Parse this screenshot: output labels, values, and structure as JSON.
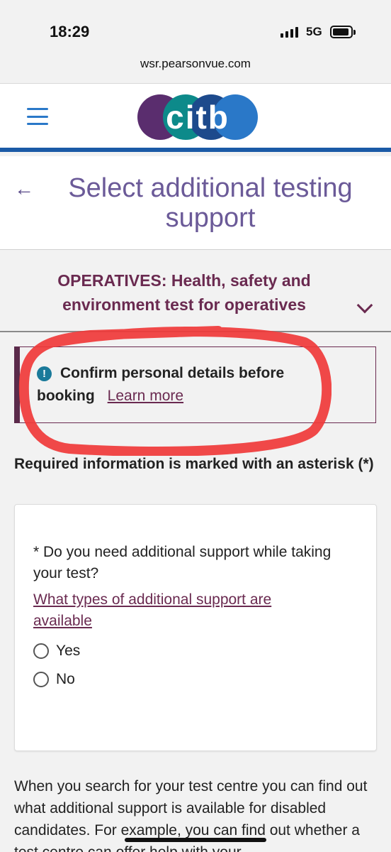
{
  "status_bar": {
    "time": "18:29",
    "network": "5G",
    "url": "wsr.pearsonvue.com"
  },
  "header": {
    "logo_text": "citb",
    "logo_colors": [
      "#5a2d6e",
      "#0d8a8a",
      "#1d4a8c",
      "#2a78c8"
    ],
    "accent": "#1b5aa6"
  },
  "page": {
    "title": "Select additional testing support"
  },
  "exam": {
    "name": "OPERATIVES: Health, safety and environment test for operatives"
  },
  "alert": {
    "text_bold": "Confirm personal details before",
    "text_bold_2": "booking",
    "link": "Learn more"
  },
  "form": {
    "required_note": "Required information is marked with an asterisk (*)",
    "question": "* Do you need additional support while taking your test?",
    "help_link": "What types of additional support are available",
    "options": [
      "Yes",
      "No"
    ]
  },
  "footer_text": "When you search for your test centre you can find out what additional support is available for disabled candidates. For example, you can find out whether a test centre can offer help with your"
}
